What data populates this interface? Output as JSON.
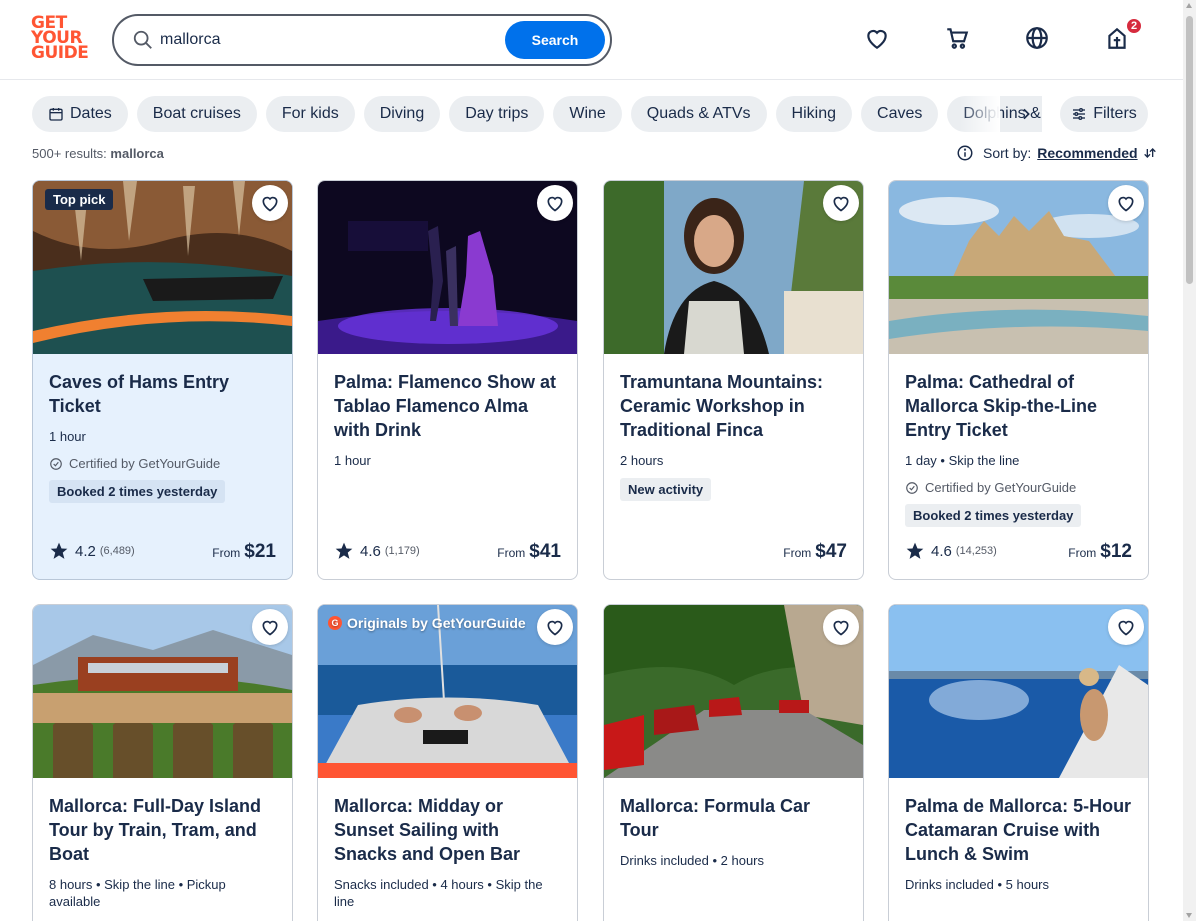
{
  "brand": {
    "logo": [
      "GET",
      "YOUR",
      "GUIDE"
    ]
  },
  "search": {
    "value": "mallorca",
    "button": "Search"
  },
  "header": {
    "cart_count": "2"
  },
  "chips": [
    {
      "label": "Dates",
      "icon": "calendar-icon"
    },
    {
      "label": "Boat cruises"
    },
    {
      "label": "For kids"
    },
    {
      "label": "Diving"
    },
    {
      "label": "Day trips"
    },
    {
      "label": "Wine"
    },
    {
      "label": "Quads & ATVs"
    },
    {
      "label": "Hiking"
    },
    {
      "label": "Caves"
    },
    {
      "label": "Dolphins & whales"
    }
  ],
  "filters_label": "Filters",
  "results": {
    "count": "500+ results:",
    "query": "mallorca"
  },
  "sort": {
    "label": "Sort by:",
    "value": "Recommended"
  },
  "cards": [
    {
      "badge": "Top pick",
      "title": "Caves of Hams Entry Ticket",
      "meta": "1 hour",
      "certified": "Certified by GetYourGuide",
      "tag": "Booked 2 times yesterday",
      "rating": "4.2",
      "reviews": "(6,489)",
      "from": "From",
      "price": "$21"
    },
    {
      "title": "Palma: Flamenco Show at Tablao Flamenco Alma with Drink",
      "meta": "1 hour",
      "rating": "4.6",
      "reviews": "(1,179)",
      "from": "From",
      "price": "$41"
    },
    {
      "title": "Tramuntana Mountains: Ceramic Workshop in Traditional Finca",
      "meta": "2 hours",
      "tag": "New activity",
      "from": "From",
      "price": "$47"
    },
    {
      "title": "Palma: Cathedral of Mallorca Skip-the-Line Entry Ticket",
      "meta": "1 day • Skip the line",
      "certified": "Certified by GetYourGuide",
      "tag": "Booked 2 times yesterday",
      "rating": "4.6",
      "reviews": "(14,253)",
      "from": "From",
      "price": "$12"
    },
    {
      "title": "Mallorca: Full-Day Island Tour by Train, Tram, and Boat",
      "meta": "8 hours • Skip the line • Pickup available"
    },
    {
      "badge": "Originals by GetYourGuide",
      "title": "Mallorca: Midday or Sunset Sailing with Snacks and Open Bar",
      "meta": "Snacks included • 4 hours • Skip the line"
    },
    {
      "title": "Mallorca: Formula Car Tour",
      "meta": "Drinks included • 2 hours"
    },
    {
      "title": "Palma de Mallorca: 5-Hour Catamaran Cruise with Lunch & Swim",
      "meta": "Drinks included • 5 hours"
    }
  ]
}
